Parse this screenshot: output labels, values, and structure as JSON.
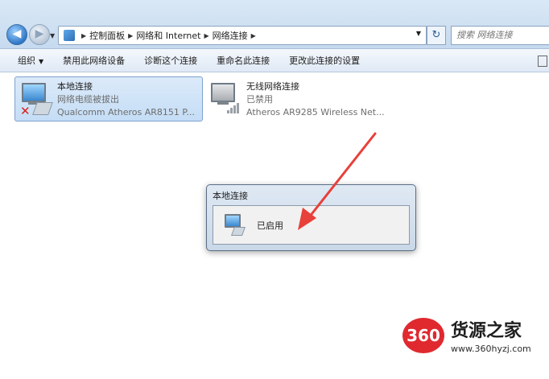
{
  "address_bar": {
    "crumbs": [
      "控制面板",
      "网络和 Internet",
      "网络连接"
    ],
    "search_placeholder": "搜索 网络连接",
    "back_icon": "back-arrow-icon",
    "forward_icon": "forward-arrow-icon",
    "refresh_icon": "refresh-icon"
  },
  "command_bar": {
    "organize": "组织",
    "disable_device": "禁用此网络设备",
    "diagnose": "诊断这个连接",
    "rename": "重命名此连接",
    "change_settings": "更改此连接的设置"
  },
  "connections": [
    {
      "name": "本地连接",
      "status": "网络电缆被拔出",
      "adapter": "Qualcomm Atheros AR8151 P...",
      "selected": true
    },
    {
      "name": "无线网络连接",
      "status": "已禁用",
      "adapter": "Atheros AR9285 Wireless Net...",
      "selected": false
    }
  ],
  "dialog": {
    "title": "本地连接",
    "status": "已启用"
  },
  "watermark": {
    "badge": "360",
    "name": "货源之家",
    "url": "www.360hyzj.com"
  },
  "colors": {
    "arrow": "#e8403a",
    "selection": "#c4ddf6",
    "watermark_badge": "#e0292f"
  }
}
